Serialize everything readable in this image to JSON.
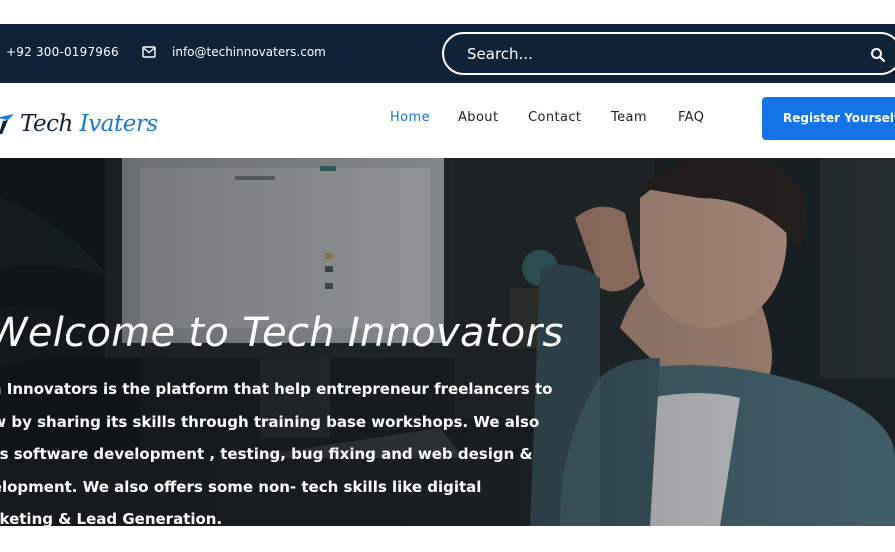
{
  "topbar": {
    "phone": "+92 300-0197966",
    "email": "info@techinnovaters.com",
    "search_placeholder": "Search..."
  },
  "logo": {
    "text_dark": "Tech",
    "text_mid": "  I",
    "text_blue": "vaters"
  },
  "nav": {
    "items": [
      {
        "label": "Home",
        "active": true
      },
      {
        "label": "About",
        "active": false
      },
      {
        "label": "Contact",
        "active": false
      },
      {
        "label": "Team",
        "active": false
      },
      {
        "label": "FAQ",
        "active": false
      }
    ],
    "register_label": "Register Yourself"
  },
  "hero": {
    "title": "Welcome to Tech Innovators",
    "description_lines": [
      "ch Innovators is the platform that help entrepreneur freelancers to",
      "ow by sharing its skills through training base workshops. We also",
      "ers software development , testing, bug fixing and web design &",
      "velopment. We also offers some non- tech skills like digital",
      "arketing & Lead Generation."
    ]
  },
  "colors": {
    "topbar_bg": "#0f2238",
    "accent_blue": "#1473e6",
    "nav_active": "#1a73d9"
  },
  "icons": {
    "mail": "mail-icon",
    "search": "search-icon",
    "logo": "logo-mark-icon"
  }
}
